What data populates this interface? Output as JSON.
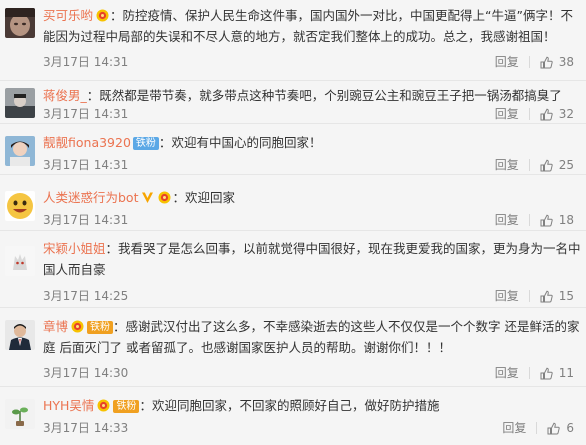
{
  "colors": {
    "username": "#eb7350",
    "text": "#333333",
    "meta": "#808080",
    "fan_badge": "#5ba8e6",
    "fan_badge_orange": "#f0a020",
    "background": "#f5f5f5"
  },
  "comments": [
    {
      "user": "买可乐哟",
      "colon": "：",
      "text": "防控疫情、保护人民生命这件事，国内国外一对比，中国更配得上“牛逼”俩字！不能因为过程中局部的失误和不尽人意的地方，就否定我们整体上的成功。总之，我感谢祖国！",
      "time": "3月17日 14:31",
      "reply": "回复",
      "likes": "38"
    },
    {
      "user": "蒋俊男_",
      "colon": "：",
      "text": "既然都是带节奏，就多带点这种节奏吧，个别豌豆公主和豌豆王子把一锅汤都搞臭了",
      "time": "3月17日 14:31",
      "reply": "回复",
      "likes": "32"
    },
    {
      "user": "靓靓fiona3920",
      "fan": "铁粉",
      "colon": "：",
      "text": "欢迎有中国心的同胞回家！",
      "time": "3月17日 14:31",
      "reply": "回复",
      "likes": "25"
    },
    {
      "user": "人类迷惑行为bot",
      "colon": "：",
      "text": "欢迎回家",
      "time": "3月17日 14:31",
      "reply": "回复",
      "likes": "18"
    },
    {
      "user": "宋颖小姐姐",
      "colon": "：",
      "text": "我看哭了是怎么回事，以前就觉得中国很好，现在我更爱我的国家，更为身为一名中国人而自豪",
      "time": "3月17日 14:25",
      "reply": "回复",
      "likes": "15"
    },
    {
      "user": "章博",
      "fan": "铁粉",
      "colon": "：",
      "text": "感谢武汉付出了这么多，不幸感染逝去的这些人不仅仅是一个个数字 还是鲜活的家庭  后面灭门了 或者留孤了。也感谢国家医护人员的帮助。谢谢你们！！！",
      "time": "3月17日 14:30",
      "reply": "回复",
      "likes": "11"
    },
    {
      "user": "HYH吴情",
      "fan": "铁粉",
      "colon": "：",
      "text": "欢迎同胞回家，不回家的照顾好自己，做好防护措施",
      "time": "3月17日 14:33",
      "reply": "回复",
      "likes": "6"
    }
  ]
}
